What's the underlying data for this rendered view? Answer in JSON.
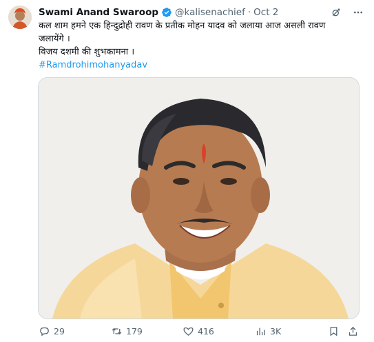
{
  "author": {
    "name": "Swami Anand Swaroop",
    "handle": "@kalisenachief",
    "separator": "·",
    "date": "Oct 2"
  },
  "body": {
    "lines": [
      "कल शाम हमने एक हिन्दुद्रोही रावण के प्रतीक मोहन यादव को जलाया आज असली रावण",
      "जलायेंगे ।",
      "विजय दशमी की शुभकामना ।"
    ],
    "hashtag": "#Ramdrohimohanyadav"
  },
  "header_icons": [
    "grok-icon",
    "more-icon"
  ],
  "actions": {
    "replies": "29",
    "retweets": "179",
    "likes": "416",
    "views": "3K"
  },
  "colors": {
    "accent": "#1d9bf0",
    "secondary_text": "#536471",
    "border": "#cfd9de"
  }
}
